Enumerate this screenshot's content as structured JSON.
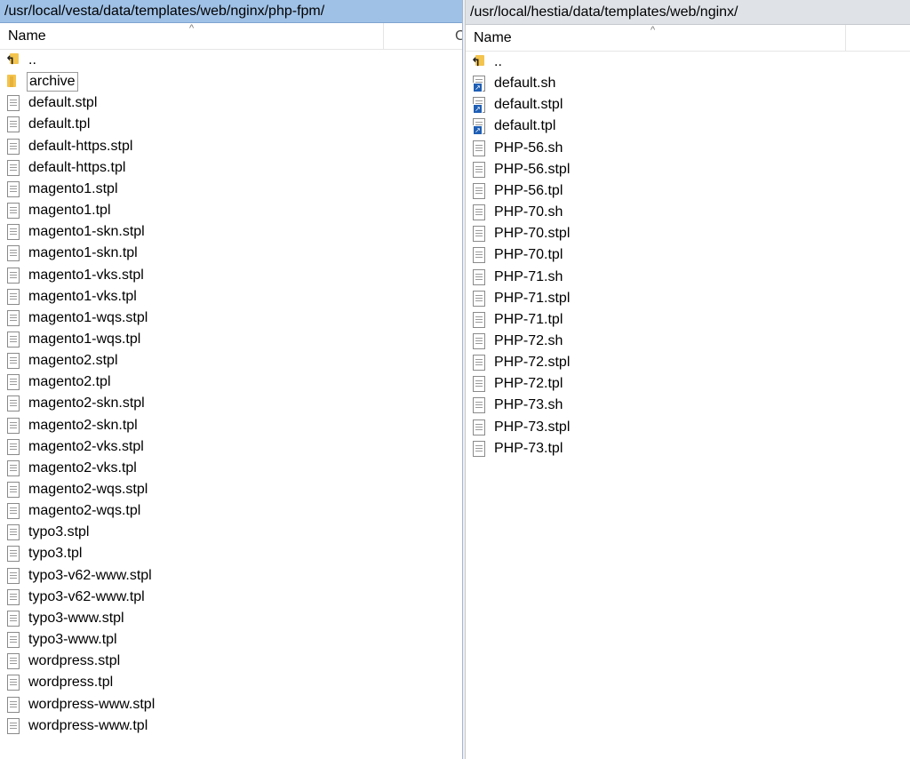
{
  "left": {
    "path": "/usr/local/vesta/data/templates/web/nginx/php-fpm/",
    "column_name": "Name",
    "sort_indicator": "^",
    "cut_column": "C",
    "items": [
      {
        "name": "..",
        "type": "parent"
      },
      {
        "name": "archive",
        "type": "folder",
        "selected": true
      },
      {
        "name": "default.stpl",
        "type": "file"
      },
      {
        "name": "default.tpl",
        "type": "file"
      },
      {
        "name": "default-https.stpl",
        "type": "file"
      },
      {
        "name": "default-https.tpl",
        "type": "file"
      },
      {
        "name": "magento1.stpl",
        "type": "file"
      },
      {
        "name": "magento1.tpl",
        "type": "file"
      },
      {
        "name": "magento1-skn.stpl",
        "type": "file"
      },
      {
        "name": "magento1-skn.tpl",
        "type": "file"
      },
      {
        "name": "magento1-vks.stpl",
        "type": "file"
      },
      {
        "name": "magento1-vks.tpl",
        "type": "file"
      },
      {
        "name": "magento1-wqs.stpl",
        "type": "file"
      },
      {
        "name": "magento1-wqs.tpl",
        "type": "file"
      },
      {
        "name": "magento2.stpl",
        "type": "file"
      },
      {
        "name": "magento2.tpl",
        "type": "file"
      },
      {
        "name": "magento2-skn.stpl",
        "type": "file"
      },
      {
        "name": "magento2-skn.tpl",
        "type": "file"
      },
      {
        "name": "magento2-vks.stpl",
        "type": "file"
      },
      {
        "name": "magento2-vks.tpl",
        "type": "file"
      },
      {
        "name": "magento2-wqs.stpl",
        "type": "file"
      },
      {
        "name": "magento2-wqs.tpl",
        "type": "file"
      },
      {
        "name": "typo3.stpl",
        "type": "file"
      },
      {
        "name": "typo3.tpl",
        "type": "file"
      },
      {
        "name": "typo3-v62-www.stpl",
        "type": "file"
      },
      {
        "name": "typo3-v62-www.tpl",
        "type": "file"
      },
      {
        "name": "typo3-www.stpl",
        "type": "file"
      },
      {
        "name": "typo3-www.tpl",
        "type": "file"
      },
      {
        "name": "wordpress.stpl",
        "type": "file"
      },
      {
        "name": "wordpress.tpl",
        "type": "file"
      },
      {
        "name": "wordpress-www.stpl",
        "type": "file"
      },
      {
        "name": "wordpress-www.tpl",
        "type": "file"
      }
    ]
  },
  "right": {
    "path": "/usr/local/hestia/data/templates/web/nginx/",
    "column_name": "Name",
    "sort_indicator": "^",
    "items": [
      {
        "name": "..",
        "type": "parent"
      },
      {
        "name": "default.sh",
        "type": "link"
      },
      {
        "name": "default.stpl",
        "type": "link"
      },
      {
        "name": "default.tpl",
        "type": "link"
      },
      {
        "name": "PHP-56.sh",
        "type": "file"
      },
      {
        "name": "PHP-56.stpl",
        "type": "file"
      },
      {
        "name": "PHP-56.tpl",
        "type": "file"
      },
      {
        "name": "PHP-70.sh",
        "type": "file"
      },
      {
        "name": "PHP-70.stpl",
        "type": "file"
      },
      {
        "name": "PHP-70.tpl",
        "type": "file"
      },
      {
        "name": "PHP-71.sh",
        "type": "file"
      },
      {
        "name": "PHP-71.stpl",
        "type": "file"
      },
      {
        "name": "PHP-71.tpl",
        "type": "file"
      },
      {
        "name": "PHP-72.sh",
        "type": "file"
      },
      {
        "name": "PHP-72.stpl",
        "type": "file"
      },
      {
        "name": "PHP-72.tpl",
        "type": "file"
      },
      {
        "name": "PHP-73.sh",
        "type": "file"
      },
      {
        "name": "PHP-73.stpl",
        "type": "file"
      },
      {
        "name": "PHP-73.tpl",
        "type": "file"
      }
    ]
  },
  "icons": {
    "parent": "parent-directory-icon",
    "folder": "folder-icon",
    "file": "document-icon",
    "link": "shortcut-document-icon"
  }
}
